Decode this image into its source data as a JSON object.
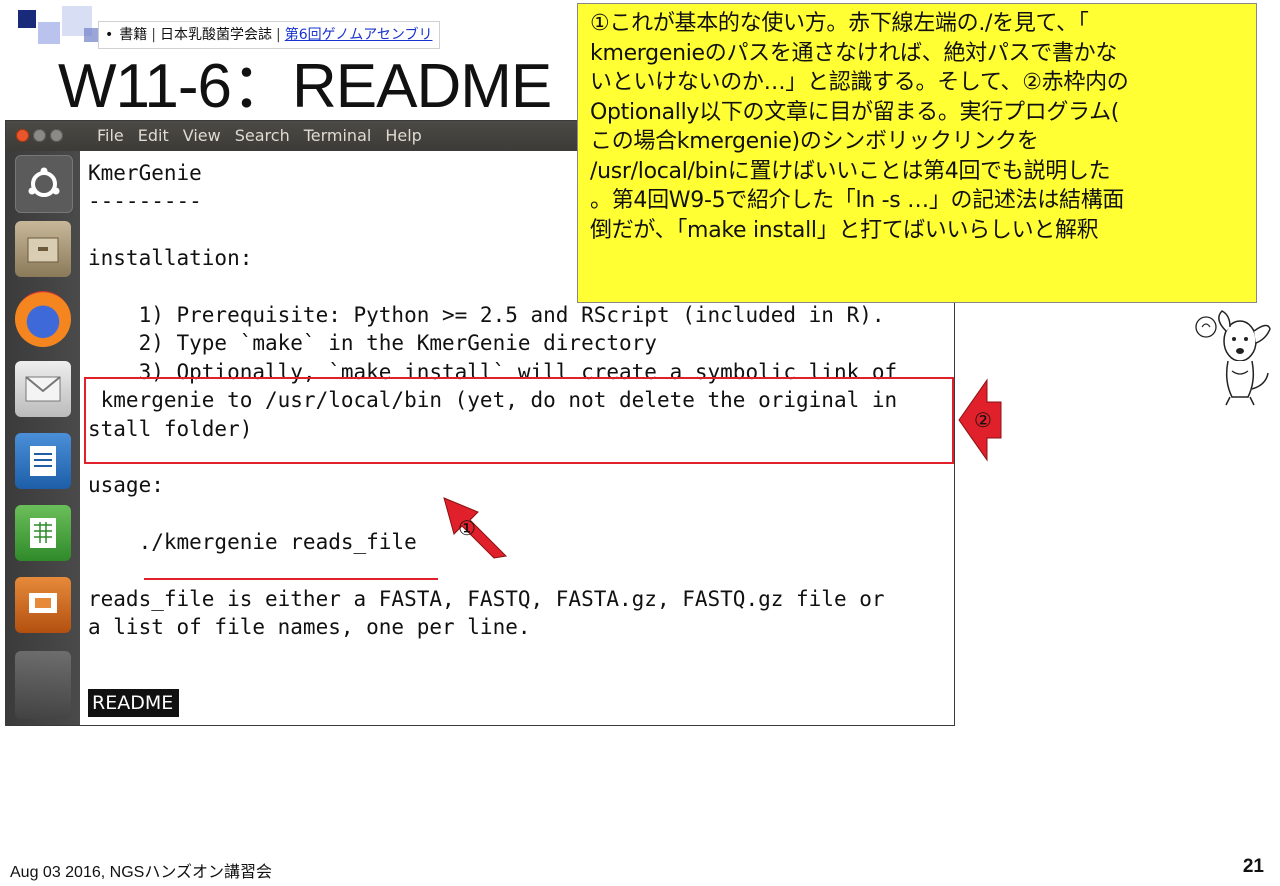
{
  "slide": {
    "title": "W11-6：README",
    "breadcrumb": {
      "bullet": "•",
      "item1": "書籍",
      "item2": "日本乳酸菌学会誌",
      "item3": "第6回ゲノムアセンブリ"
    },
    "footer": "Aug 03 2016, NGSハンズオン講習会",
    "page_number": "21"
  },
  "terminal": {
    "menu": [
      "File",
      "Edit",
      "View",
      "Search",
      "Terminal",
      "Help"
    ],
    "lines": [
      "KmerGenie",
      "---------",
      "",
      "installation:",
      "",
      "    1) Prerequisite: Python >= 2.5 and RScript (included in R).",
      "    2) Type `make` in the KmerGenie directory",
      "    3) Optionally, `make install` will create a symbolic link of",
      " kmergenie to /usr/local/bin (yet, do not delete the original in",
      "stall folder)",
      "",
      "usage:",
      "",
      "    ./kmergenie reads_file",
      "",
      "reads_file is either a FASTA, FASTQ, FASTA.gz, FASTQ.gz file or",
      "a list of file names, one per line.",
      ""
    ],
    "status": "README"
  },
  "annotation": {
    "lines": [
      "①これが基本的な使い方。赤下線左端の./を見て、「",
      "kmergenieのパスを通さなければ、絶対パスで書かな",
      "いといけないのか…」と認識する。そして、②赤枠内の",
      "Optionally以下の文章に目が留まる。実行プログラム(",
      "この場合kmergenie)のシンボリックリンクを",
      "/usr/local/binに置けばいいことは第4回でも説明した",
      "。第4回W9-5で紹介した「ln -s …」の記述法は結構面",
      "倒だが、「make install」と打てばいいらしいと解釈"
    ]
  },
  "markers": {
    "one": "①",
    "two": "②"
  },
  "colors": {
    "highlight_red": "#e0202a",
    "note_yellow": "#ffff33",
    "terminal_bar": "#3c3b37",
    "link_blue": "#1a33cc"
  }
}
